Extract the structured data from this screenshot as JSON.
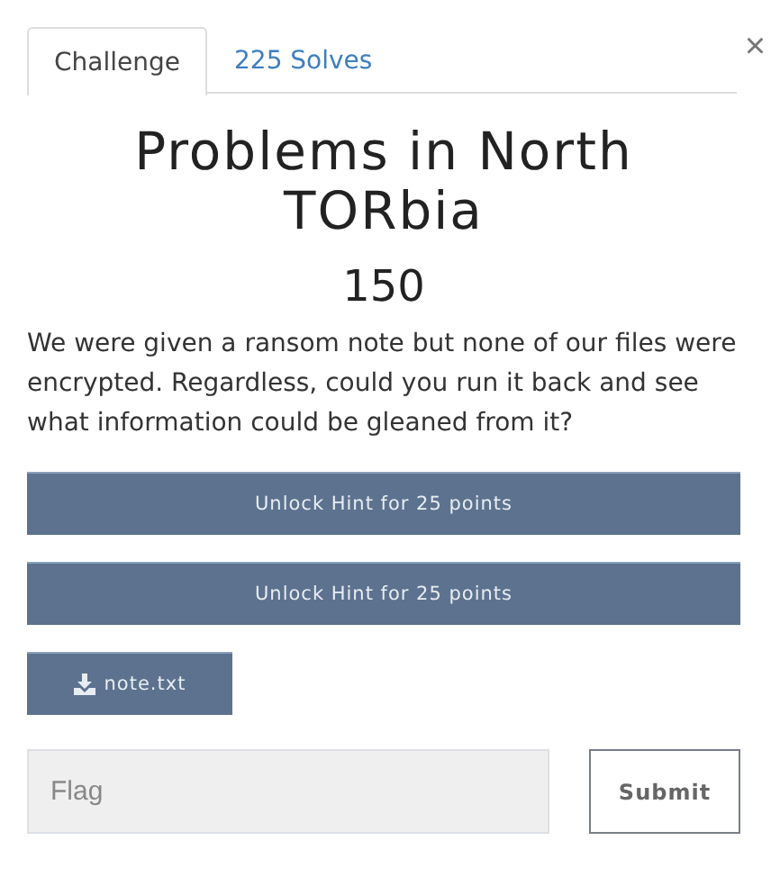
{
  "tabs": [
    {
      "label": "Challenge",
      "selected": true
    },
    {
      "label": "225 Solves",
      "selected": false
    }
  ],
  "close": "×",
  "challenge": {
    "title": "Problems in North TORbia",
    "points": "150",
    "description": "We were given a ransom note but none of our files were encrypted. Regardless, could you run it back and see what information could be gleaned from it?"
  },
  "hints": [
    "Unlock Hint for 25 points",
    "Unlock Hint for 25 points"
  ],
  "files": [
    "note.txt"
  ],
  "flag": {
    "placeholder": "Flag"
  },
  "submit": "Submit"
}
